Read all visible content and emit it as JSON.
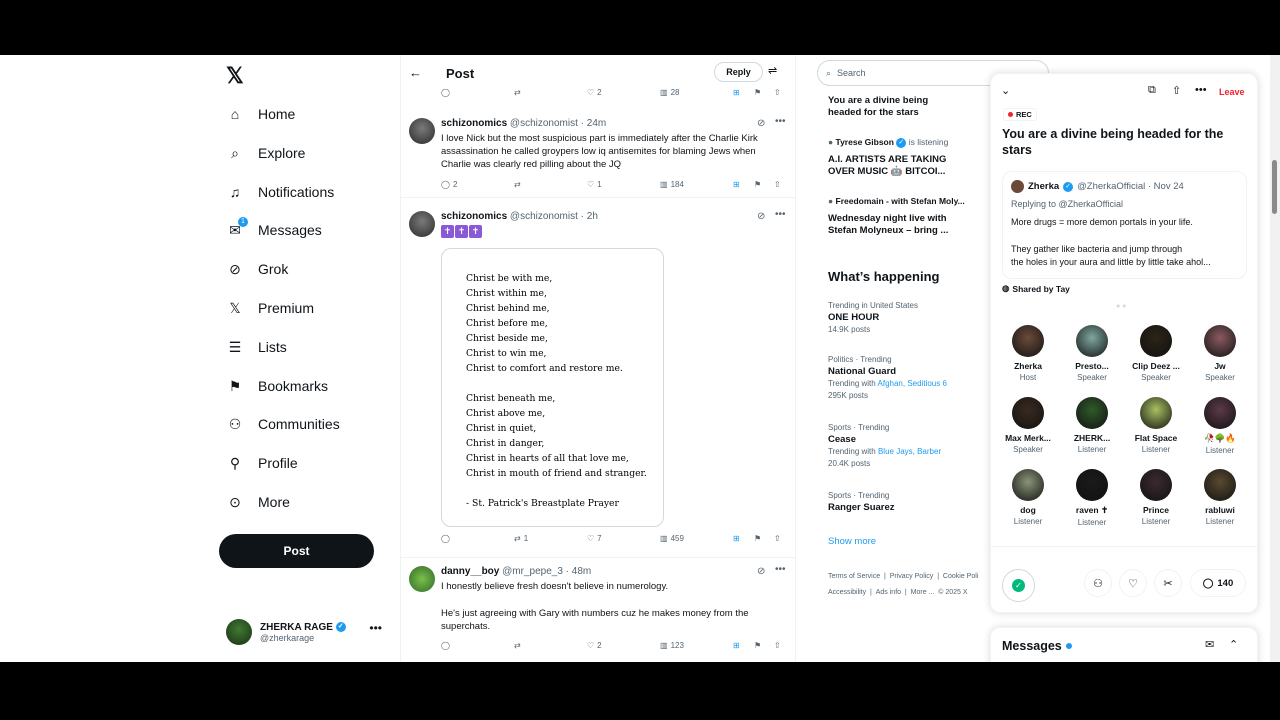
{
  "nav": {
    "logo": "𝕏",
    "items": [
      {
        "label": "Home",
        "icon": "home-icon",
        "glyph": "⌂"
      },
      {
        "label": "Explore",
        "icon": "search-icon",
        "glyph": "⌕"
      },
      {
        "label": "Notifications",
        "icon": "bell-icon",
        "glyph": "♫"
      },
      {
        "label": "Messages",
        "icon": "envelope-icon",
        "glyph": "✉",
        "badge": "1"
      },
      {
        "label": "Grok",
        "icon": "grok-icon",
        "glyph": "⊘"
      },
      {
        "label": "Premium",
        "icon": "x-premium-icon",
        "glyph": "𝕏"
      },
      {
        "label": "Lists",
        "icon": "list-icon",
        "glyph": "☰"
      },
      {
        "label": "Bookmarks",
        "icon": "bookmark-icon",
        "glyph": "⚑"
      },
      {
        "label": "Communities",
        "icon": "people-icon",
        "glyph": "⚇"
      },
      {
        "label": "Profile",
        "icon": "person-icon",
        "glyph": "⚲"
      },
      {
        "label": "More",
        "icon": "more-circle-icon",
        "glyph": "⊙"
      }
    ],
    "post_label": "Post",
    "account": {
      "name": "ZHERKA RAGE",
      "handle": "@zherkarage"
    }
  },
  "thread": {
    "title": "Post",
    "reply_label": "Reply",
    "top_actions": {
      "replies": "",
      "reposts": "",
      "likes": "2",
      "views": "28"
    },
    "tweets": [
      {
        "name": "schizonomics",
        "meta": "@schizonomist · 24m",
        "text": "I love Nick but the most suspicious part is immediately after the Charlie Kirk assassination he called groypers low iq antisemites for blaming Jews when Charlie was clearly red pilling about the JQ",
        "replies": "2",
        "reposts": "",
        "likes": "1",
        "views": "184"
      },
      {
        "name": "schizonomics",
        "meta": "@schizonomist · 2h",
        "emoji": [
          "✝",
          "✝",
          "✝"
        ],
        "prayer_lines": [
          "Christ be with me,",
          "Christ within me,",
          "Christ behind me,",
          "Christ before me,",
          "Christ beside me,",
          "Christ to win me,",
          "Christ to comfort and restore me.",
          "",
          "Christ beneath me,",
          "Christ above me,",
          "Christ in quiet,",
          "Christ in danger,",
          "Christ in hearts of all that love me,",
          "Christ in mouth of friend and stranger.",
          "",
          "- St. Patrick's Breastplate Prayer"
        ],
        "replies": "",
        "reposts": "1",
        "likes": "7",
        "views": "459"
      },
      {
        "name": "danny__boy",
        "meta": "@mr_pepe_3 · 48m",
        "text1": "I honestly believe fresh doesn't believe in numerology.",
        "text2": "He's just agreeing with Gary with numbers cuz he makes money from the superchats.",
        "replies": "",
        "reposts": "",
        "likes": "2",
        "views": "123"
      }
    ]
  },
  "right": {
    "search_placeholder": "Search",
    "spaces": [
      {
        "title1": "You are a divine being",
        "title2": "headed for the stars"
      },
      {
        "host": "Tyrese Gibson",
        "status": "is listening",
        "title1": "A.I. ARTISTS ARE TAKING",
        "title2": "OVER MUSIC 🤖 BITCOI..."
      },
      {
        "host": "Freedomain - with Stefan Moly...",
        "title1": "Wednesday night live with",
        "title2": "Stefan Molyneux – bring ..."
      }
    ],
    "whats_happening": "What’s happening",
    "trends": [
      {
        "context": "Trending in United States",
        "name": "ONE HOUR",
        "posts": "14.9K posts"
      },
      {
        "context": "Politics · Trending",
        "name": "National Guard",
        "with_prefix": "Trending with",
        "with": "Afghan, Seditious 6",
        "posts": "295K posts"
      },
      {
        "context": "Sports · Trending",
        "name": "Cease",
        "with_prefix": "Trending with",
        "with": "Blue Jays, Barber",
        "posts": "20.4K posts"
      },
      {
        "context": "Sports · Trending",
        "name": "Ranger Suarez"
      }
    ],
    "show_more": "Show more",
    "footer1": [
      "Terms of Service",
      "Privacy Policy",
      "Cookie Poli"
    ],
    "footer2": [
      "Accessibility",
      "Ads info",
      "More ...",
      "© 2025 X"
    ]
  },
  "space": {
    "leave_label": "Leave",
    "rec_label": "REC",
    "title": "You are a divine being headed for the stars",
    "quote": {
      "name": "Zherka",
      "meta": "@ZherkaOfficial · Nov 24",
      "replying": "Replying to @ZherkaOfficial",
      "line1": "More drugs = more demon portals in your life.",
      "line2": "They gather like bacteria and jump through",
      "line3": "the holes in your aura and little by little take ahol..."
    },
    "shared_by": "Shared by Tay",
    "participants": [
      {
        "name": "Zherka",
        "role": "Host",
        "color": "#6b4a3a"
      },
      {
        "name": "Presto...",
        "role": "Speaker",
        "color": "#7fa8a0"
      },
      {
        "name": "Clip Deez ...",
        "role": "Speaker",
        "color": "#2b2418"
      },
      {
        "name": "Jw",
        "role": "Speaker",
        "color": "#8a5a60"
      },
      {
        "name": "Max Merk...",
        "role": "Speaker",
        "color": "#3a2a20"
      },
      {
        "name": "ZHERK...",
        "role": "Listener",
        "color": "#2f5a2a"
      },
      {
        "name": "Flat Space",
        "role": "Listener",
        "color": "#a8c060"
      },
      {
        "name": "🥀🌳🔥",
        "role": "Listener",
        "color": "#5a3a48"
      },
      {
        "name": "dog",
        "role": "Listener",
        "color": "#8a9478"
      },
      {
        "name": "raven ✝",
        "role": "Listener",
        "color": "#1a1a1a"
      },
      {
        "name": "Prince",
        "role": "Listener",
        "color": "#3a2a30"
      },
      {
        "name": "rabluwi",
        "role": "Listener",
        "color": "#5a4a30"
      }
    ],
    "comment_count": "140"
  },
  "dm": {
    "title": "Messages"
  }
}
